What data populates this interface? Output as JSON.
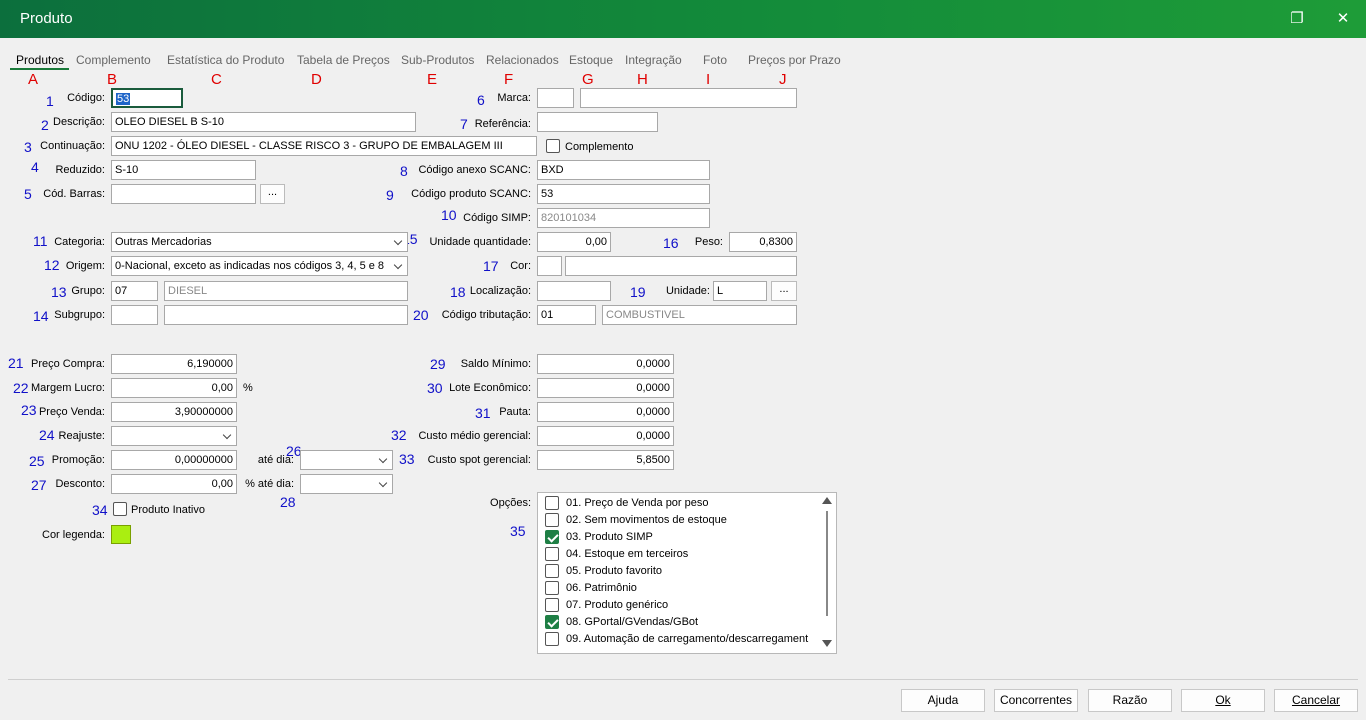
{
  "window": {
    "title": "Produto"
  },
  "tabs": [
    "Produtos",
    "Complemento",
    "Estatística do Produto",
    "Tabela de Preços",
    "Sub-Produtos",
    "Relacionados",
    "Estoque",
    "Integração",
    "Foto",
    "Preços por Prazo"
  ],
  "tab_letters": [
    "A",
    "B",
    "C",
    "D",
    "E",
    "F",
    "G",
    "H",
    "I",
    "J"
  ],
  "annotations": [
    "1",
    "2",
    "3",
    "4",
    "5",
    "6",
    "7",
    "8",
    "9",
    "10",
    "11",
    "12",
    "13",
    "14",
    "15",
    "16",
    "17",
    "18",
    "19",
    "20",
    "21",
    "22",
    "23",
    "24",
    "25",
    "26",
    "27",
    "28",
    "29",
    "30",
    "31",
    "32",
    "33",
    "34",
    "35"
  ],
  "fields": {
    "codigo": {
      "label": "Código:",
      "value": "53"
    },
    "descricao": {
      "label": "Descrição:",
      "value": "OLEO DIESEL B S-10"
    },
    "continuacao": {
      "label": "Continuação:",
      "value": "ONU 1202 - ÓLEO DIESEL - CLASSE RISCO 3 - GRUPO DE EMBALAGEM III"
    },
    "reduzido": {
      "label": "Reduzido:",
      "value": "S-10"
    },
    "cod_barras": {
      "label": "Cód. Barras:",
      "value": "",
      "button": "..."
    },
    "marca": {
      "label": "Marca:",
      "value": "",
      "desc": ""
    },
    "referencia": {
      "label": "Referência:",
      "value": ""
    },
    "complemento": {
      "label": "Complemento"
    },
    "codigo_anexo_scanc": {
      "label": "Código anexo SCANC:",
      "value": "BXD"
    },
    "codigo_produto_scanc": {
      "label": "Código produto SCANC:",
      "value": "53"
    },
    "codigo_simp": {
      "label": "Código SIMP:",
      "value": "820101034"
    },
    "categoria": {
      "label": "Categoria:",
      "value": "Outras Mercadorias"
    },
    "origem": {
      "label": "Origem:",
      "value": "0-Nacional, exceto as indicadas nos códigos 3, 4, 5 e 8"
    },
    "grupo": {
      "label": "Grupo:",
      "value": "07",
      "desc": "DIESEL"
    },
    "subgrupo": {
      "label": "Subgrupo:",
      "value": "",
      "desc": ""
    },
    "unidade_quantidade": {
      "label": "Unidade quantidade:",
      "value": "0,00"
    },
    "peso": {
      "label": "Peso:",
      "value": "0,8300"
    },
    "cor": {
      "label": "Cor:",
      "value": "",
      "desc": ""
    },
    "localizacao": {
      "label": "Localização:",
      "value": ""
    },
    "unidade": {
      "label": "Unidade:",
      "value": "L",
      "button": "..."
    },
    "codigo_tributacao": {
      "label": "Código tributação:",
      "value": "01",
      "desc": "COMBUSTIVEL"
    },
    "preco_compra": {
      "label": "Preço Compra:",
      "value": "6,190000"
    },
    "margem_lucro": {
      "label": "Margem Lucro:",
      "value": "0,00",
      "unit": "%"
    },
    "preco_venda": {
      "label": "Preço Venda:",
      "value": "3,90000000"
    },
    "reajuste": {
      "label": "Reajuste:",
      "value": ""
    },
    "promocao": {
      "label": "Promoção:",
      "value": "0,00000000"
    },
    "ate_dia": {
      "label": "até dia:",
      "value": ""
    },
    "desconto": {
      "label": "Desconto:",
      "value": "0,00"
    },
    "pct_ate_dia": {
      "label": "% até dia:",
      "value": ""
    },
    "produto_inativo": {
      "label": "Produto Inativo",
      "checked": false
    },
    "cor_legenda": {
      "label": "Cor legenda:",
      "color": "#aaee11"
    },
    "saldo_minimo": {
      "label": "Saldo Mínimo:",
      "value": "0,0000"
    },
    "lote_economico": {
      "label": "Lote Econômico:",
      "value": "0,0000"
    },
    "pauta": {
      "label": "Pauta:",
      "value": "0,0000"
    },
    "custo_medio": {
      "label": "Custo médio gerencial:",
      "value": "0,0000"
    },
    "custo_spot": {
      "label": "Custo spot gerencial:",
      "value": "5,8500"
    }
  },
  "opcoes": {
    "label": "Opções:",
    "items": [
      {
        "label": "01. Preço de Venda por peso",
        "checked": false
      },
      {
        "label": "02. Sem movimentos de estoque",
        "checked": false
      },
      {
        "label": "03. Produto SIMP",
        "checked": true
      },
      {
        "label": "04. Estoque em terceiros",
        "checked": false
      },
      {
        "label": "05. Produto favorito",
        "checked": false
      },
      {
        "label": "06. Patrimônio",
        "checked": false
      },
      {
        "label": "07. Produto genérico",
        "checked": false
      },
      {
        "label": "08. GPortal/GVendas/GBot",
        "checked": true
      },
      {
        "label": "09. Automação de carregamento/descarregament",
        "checked": false
      }
    ]
  },
  "footer": {
    "ajuda": "Ajuda",
    "concorrentes": "Concorrentes",
    "razao": "Razão",
    "ok": "Ok",
    "cancelar": "Cancelar"
  }
}
